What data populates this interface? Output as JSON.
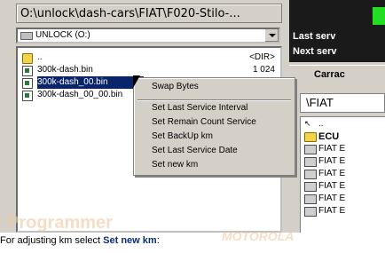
{
  "path": "O:\\unlock\\dash-cars\\FIAT\\F020-Stilo-...",
  "drive": "UNLOCK (O:)",
  "files": [
    {
      "name": "..",
      "size": "<DIR>",
      "type": "folder"
    },
    {
      "name": "300k-dash.bin",
      "size": "1 024",
      "type": "file"
    },
    {
      "name": "300k-dash_00.bin",
      "size": "",
      "type": "file",
      "selected": true
    },
    {
      "name": "300k-dash_00_00.bin",
      "size": "",
      "type": "file"
    }
  ],
  "context_menu": [
    "Swap Bytes",
    "Set Last Service Interval",
    "Set Remain Count Service",
    "Set BackUp km",
    "Set Last Service Date",
    "Set new km"
  ],
  "right_panel": {
    "line1": "Last serv",
    "line2": "Next serv",
    "tab": "Carrac",
    "path": "\\FIAT",
    "items": [
      {
        "name": "..",
        "type": "up"
      },
      {
        "name": "ECU",
        "type": "folder"
      },
      {
        "name": "FIAT E",
        "type": "chip"
      },
      {
        "name": "FIAT E",
        "type": "chip"
      },
      {
        "name": "FIAT E",
        "type": "chip"
      },
      {
        "name": "FIAT E",
        "type": "chip"
      },
      {
        "name": "FIAT E",
        "type": "chip"
      },
      {
        "name": "FIAT E",
        "type": "chip"
      }
    ]
  },
  "caption": {
    "prefix": "For adjusting  km select ",
    "bold": "Set new km",
    "suffix": ":"
  },
  "watermarks": [
    "Programmer",
    "MOTOROLA"
  ]
}
